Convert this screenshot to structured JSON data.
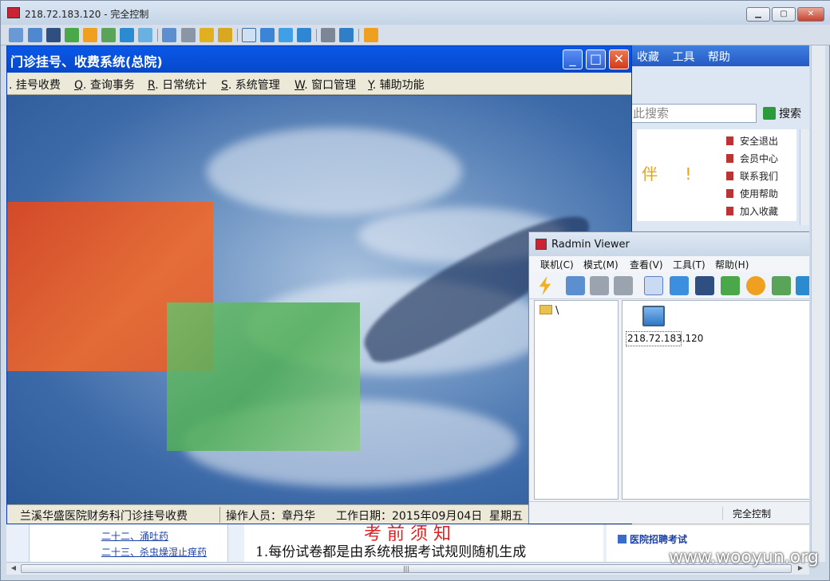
{
  "outer_window": {
    "title": "218.72.183.120 - 完全控制",
    "toolbar_icons": [
      "fit-screen-icon",
      "fullscreen-icon",
      "terminal-icon",
      "transfer-icon",
      "power-icon",
      "chat-icon",
      "voice-icon",
      "message-icon",
      "upload-icon",
      "network-icon",
      "lock-icon",
      "unlock-icon",
      "normal-view-icon",
      "stretch-view-icon",
      "fullscreen-view-icon",
      "refresh-icon",
      "screenshot-icon",
      "settings-icon",
      "close-session-icon"
    ]
  },
  "browser_back": {
    "menu": [
      "收藏",
      "工具",
      "帮助"
    ],
    "search_placeholder": "此搜索",
    "search_button": "搜索",
    "slogan": "伴 !",
    "quick_links": [
      "安全退出",
      "会员中心",
      "联系我们",
      "使用帮助",
      "加入收藏"
    ]
  },
  "his_app": {
    "title": "门诊挂号、收费系统(总院)",
    "menu": [
      {
        "key": "",
        "label": ". 挂号收费"
      },
      {
        "key": "Q",
        "label": ". 查询事务"
      },
      {
        "key": "R",
        "label": ". 日常统计"
      },
      {
        "key": "S",
        "label": ". 系统管理"
      },
      {
        "key": "W",
        "label": ". 窗口管理"
      },
      {
        "key": "Y",
        "label": ". 辅助功能"
      }
    ],
    "status": {
      "dept": "兰溪华盛医院财务科门诊挂号收费",
      "operator": "操作人员：章丹华",
      "workdate": "工作日期：2015年09月04日",
      "weekday": "星期五"
    }
  },
  "radmin": {
    "title": "Radmin Viewer",
    "menu": [
      "联机(C)",
      "模式(M)",
      "查看(V)",
      "工具(T)",
      "帮助(H)"
    ],
    "tree_root": "\\",
    "connection_label": "218.72.183.120",
    "status_mode": "完全控制"
  },
  "web_strip": {
    "links": [
      "二十二、涌吐药",
      "二十三、杀虫燥湿止痒药"
    ],
    "big_heading": "考 前 须 知",
    "notice": "1.每份试卷都是由系统根据考试规则随机生成",
    "recruit": "医院招聘考试"
  },
  "watermark": "www.wooyun.org"
}
